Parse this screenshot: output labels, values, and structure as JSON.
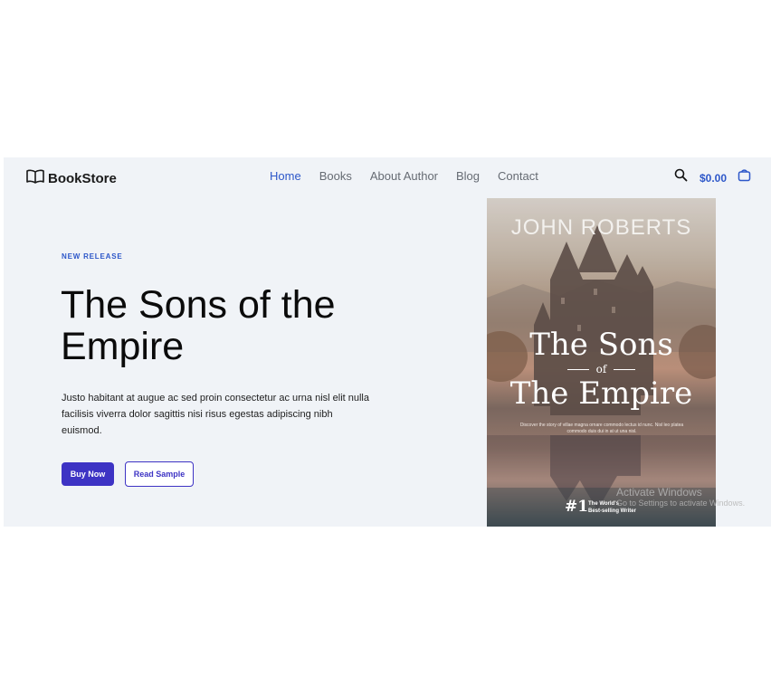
{
  "header": {
    "logo_text": "BookStore",
    "nav": [
      {
        "label": "Home",
        "active": true
      },
      {
        "label": "Books",
        "active": false
      },
      {
        "label": "About Author",
        "active": false
      },
      {
        "label": "Blog",
        "active": false
      },
      {
        "label": "Contact",
        "active": false
      }
    ],
    "cart_total": "$0.00",
    "icons": {
      "logo": "open-book-icon",
      "search": "search-icon",
      "cart": "shopping-bag-icon"
    }
  },
  "hero": {
    "eyebrow": "NEW RELEASE",
    "title": "The Sons of the Empire",
    "description": "Justo habitant at augue ac sed proin consectetur ac urna nisl elit nulla facilisis viverra dolor sagittis nisi risus egestas adipiscing nibh euismod.",
    "buy_label": "Buy Now",
    "sample_label": "Read Sample"
  },
  "cover": {
    "author": "JOHN ROBERTS",
    "title_line1": "The Sons",
    "title_of": "of",
    "title_line2": "The Empire",
    "blurb": "Discover the story of villae magna ornare commodo lectus id nunc. Nisl leo platea commodo duis dui in at ut una nisl.",
    "rank": "#1",
    "rank_text_line1": "The World's",
    "rank_text_line2": "Best-selling Writer"
  },
  "watermark": {
    "title": "Activate Windows",
    "subtitle": "Go to Settings to activate Windows."
  },
  "colors": {
    "accent": "#2d57c9",
    "button": "#3d33c4",
    "hero_bg": "#f0f3f7"
  }
}
